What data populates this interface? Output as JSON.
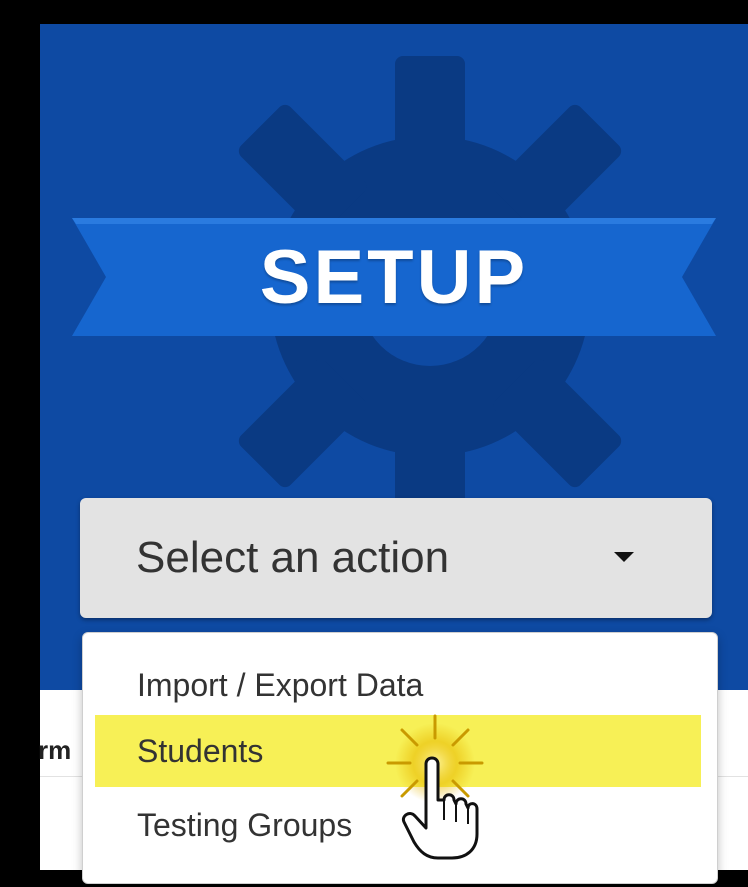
{
  "header": {
    "title": "SETUP"
  },
  "action_select": {
    "selected_label": "Select an action"
  },
  "menu": {
    "items": [
      {
        "label": "Import / Export Data"
      },
      {
        "label": "Students"
      },
      {
        "label": "Testing Groups"
      }
    ]
  },
  "background": {
    "column_fragment": "rm"
  },
  "colors": {
    "panel": "#0e4aa3",
    "gear": "#0a3a83",
    "banner": "#1666cf",
    "highlight": "#f7f056"
  },
  "icons": {
    "gear": "gear-icon",
    "caret": "chevron-down-icon",
    "cursor": "hand-pointer-icon",
    "sparkle": "sparkle-icon"
  }
}
